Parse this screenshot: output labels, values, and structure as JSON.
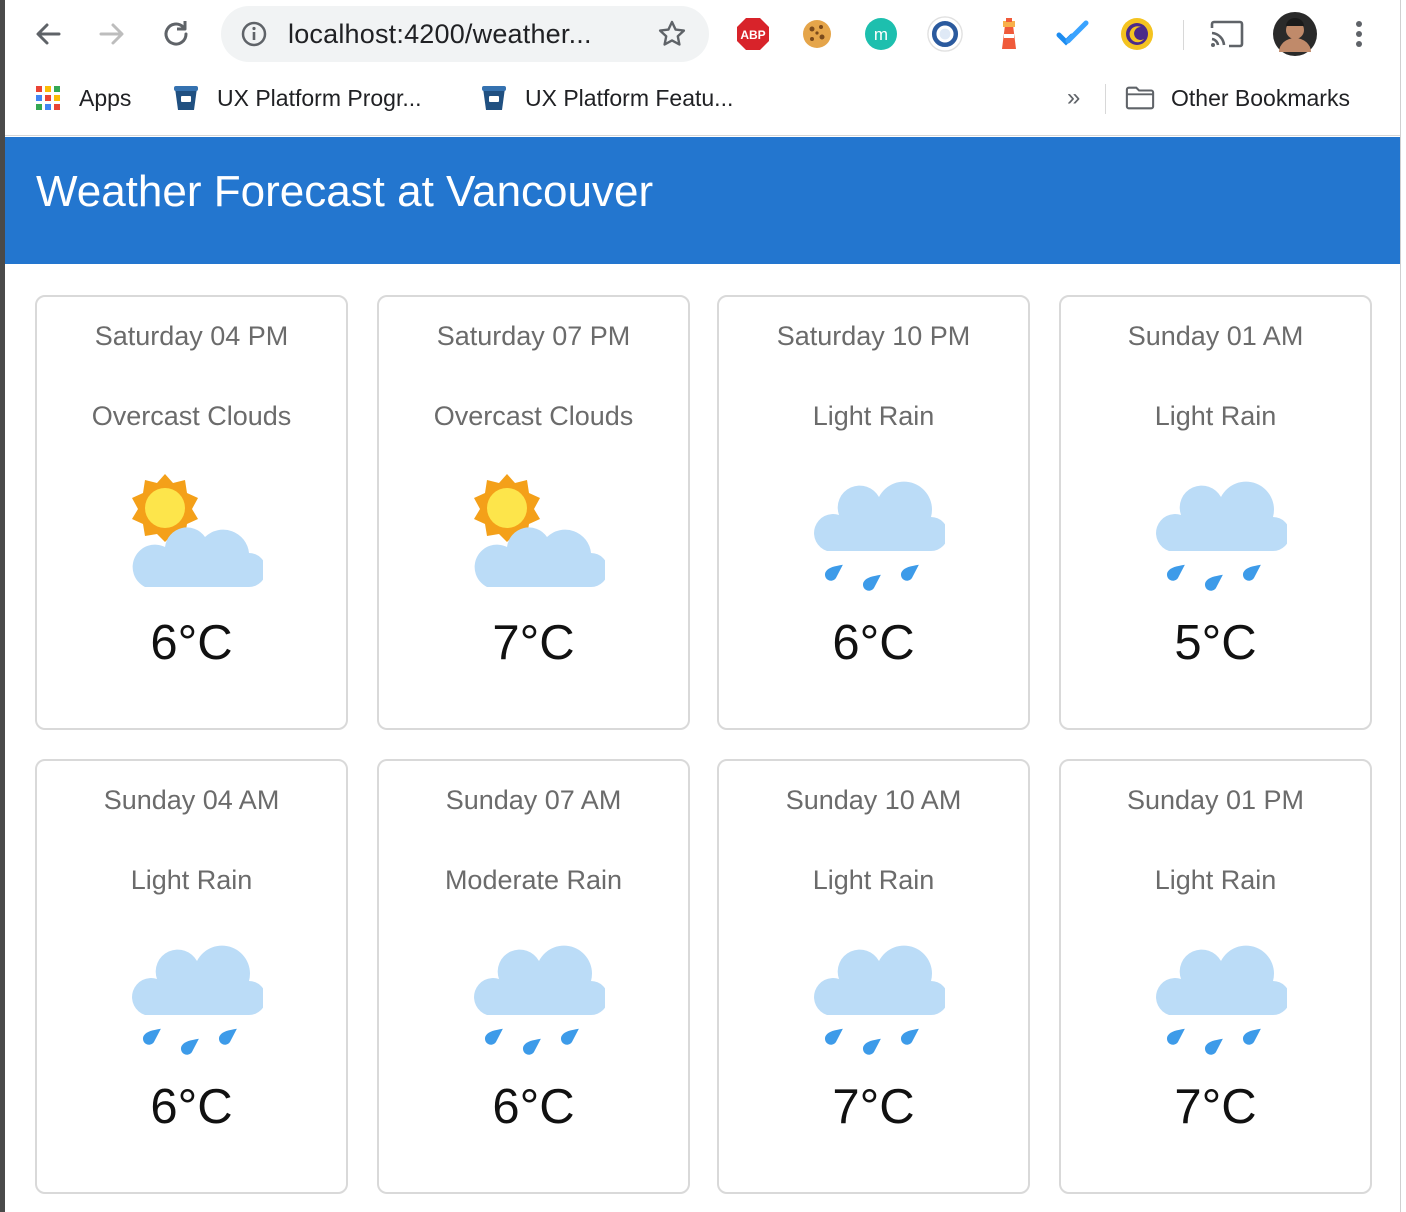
{
  "browser": {
    "url": "localhost:4200/weather...",
    "extensions": [
      "adblock-plus-icon",
      "cookie-icon",
      "mercury-icon",
      "ring-extension-icon",
      "lighthouse-icon",
      "todoist-check-icon",
      "night-mode-icon"
    ],
    "adblock_label": "ABP",
    "mercury_label": "m",
    "bookmarks": {
      "apps": "Apps",
      "item1": "UX Platform Progr...",
      "item2": "UX Platform Featu...",
      "overflow": "»",
      "other": "Other Bookmarks"
    }
  },
  "app": {
    "title": "Weather Forecast at Vancouver",
    "header_color": "#2376cf"
  },
  "forecasts": [
    {
      "time": "Saturday 04 PM",
      "description": "Overcast Clouds",
      "temp": "6°C",
      "icon": "sun-behind-cloud-icon"
    },
    {
      "time": "Saturday 07 PM",
      "description": "Overcast Clouds",
      "temp": "7°C",
      "icon": "sun-behind-cloud-icon"
    },
    {
      "time": "Saturday 10 PM",
      "description": "Light Rain",
      "temp": "6°C",
      "icon": "rain-cloud-icon"
    },
    {
      "time": "Sunday 01 AM",
      "description": "Light Rain",
      "temp": "5°C",
      "icon": "rain-cloud-icon"
    },
    {
      "time": "Sunday 04 AM",
      "description": "Light Rain",
      "temp": "6°C",
      "icon": "rain-cloud-icon"
    },
    {
      "time": "Sunday 07 AM",
      "description": "Moderate Rain",
      "temp": "6°C",
      "icon": "rain-cloud-icon"
    },
    {
      "time": "Sunday 10 AM",
      "description": "Light Rain",
      "temp": "7°C",
      "icon": "rain-cloud-icon"
    },
    {
      "time": "Sunday 01 PM",
      "description": "Light Rain",
      "temp": "7°C",
      "icon": "rain-cloud-icon"
    }
  ]
}
